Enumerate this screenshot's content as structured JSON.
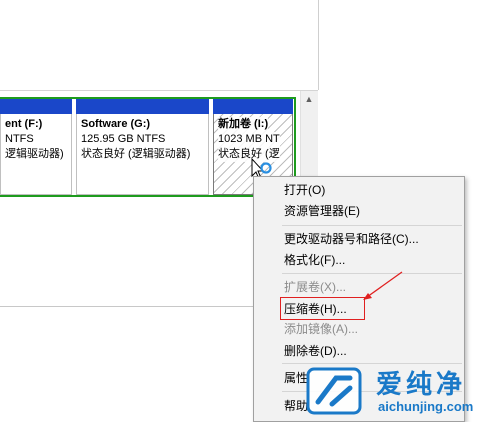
{
  "partitions": [
    {
      "name": "ent  (F:)",
      "size": "NTFS",
      "status": "逻辑驱动器)"
    },
    {
      "name": "Software  (G:)",
      "size": "125.95 GB NTFS",
      "status": "状态良好 (逻辑驱动器)"
    },
    {
      "name": "新加卷  (I:)",
      "size": "1023 MB NT",
      "status": "状态良好 (逻"
    }
  ],
  "scrollbar": {
    "up_arrow": "▲"
  },
  "context_menu": {
    "items": [
      {
        "label": "打开(O)",
        "enabled": true
      },
      {
        "label": "资源管理器(E)",
        "enabled": true
      },
      {
        "label": "更改驱动器号和路径(C)...",
        "enabled": true
      },
      {
        "label": "格式化(F)...",
        "enabled": true
      },
      {
        "label": "扩展卷(X)...",
        "enabled": false
      },
      {
        "label": "压缩卷(H)...",
        "enabled": true,
        "highlighted": true
      },
      {
        "label": "添加镜像(A)...",
        "enabled": false
      },
      {
        "label": "删除卷(D)...",
        "enabled": true
      },
      {
        "label": "属性",
        "enabled": true
      },
      {
        "label": "帮助",
        "enabled": true
      }
    ]
  },
  "watermark": {
    "brand": "爱纯净",
    "url": "aichunjing.com"
  },
  "colors": {
    "partition_bar": "#1a47c9",
    "disk_outline": "#1e9b1e",
    "highlight": "#e02020",
    "watermark": "#1a79c8"
  }
}
